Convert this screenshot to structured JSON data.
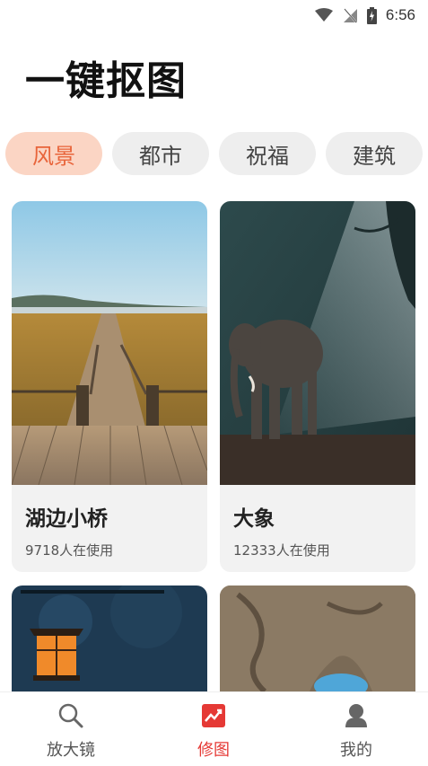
{
  "status": {
    "time": "6:56"
  },
  "header": {
    "title": "一键抠图"
  },
  "tabs": [
    {
      "label": "风景",
      "active": true
    },
    {
      "label": "都市",
      "active": false
    },
    {
      "label": "祝福",
      "active": false
    },
    {
      "label": "建筑",
      "active": false
    }
  ],
  "cards": [
    {
      "title": "湖边小桥",
      "usage": "9718人在使用"
    },
    {
      "title": "大象",
      "usage": "12333人在使用"
    }
  ],
  "nav": {
    "items": [
      {
        "label": "放大镜",
        "icon": "magnifier-icon",
        "active": false
      },
      {
        "label": "修图",
        "icon": "chart-icon",
        "active": true
      },
      {
        "label": "我的",
        "icon": "user-icon",
        "active": false
      }
    ],
    "active_color": "#e53935"
  },
  "colors": {
    "accent": "#e8643a",
    "accent_bg": "#fbd5c4"
  }
}
